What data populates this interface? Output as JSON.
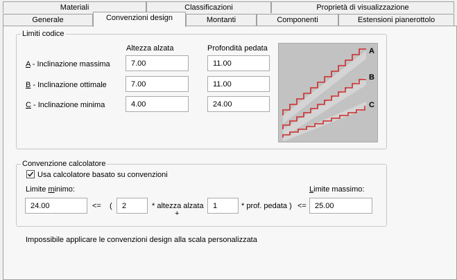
{
  "tabs_row1": [
    {
      "label": "Materiali"
    },
    {
      "label": "Classificazioni"
    },
    {
      "label": "Proprietà di visualizzazione"
    }
  ],
  "tabs_row2": [
    {
      "label": "Generale"
    },
    {
      "label": "Convenzioni design",
      "active": true
    },
    {
      "label": "Montanti"
    },
    {
      "label": "Componenti"
    },
    {
      "label": "Estensioni pianerottolo"
    }
  ],
  "limits": {
    "title": "Limiti codice",
    "col_riser": "Altezza alzata",
    "col_tread": "Profondità pedata",
    "rows": [
      {
        "key": "A",
        "rest": " - Inclinazione massima",
        "riser": "7.00",
        "tread": "11.00"
      },
      {
        "key": "B",
        "rest": " - Inclinazione ottimale",
        "riser": "7.00",
        "tread": "11.00"
      },
      {
        "key": "C",
        "rest": " - Inclinazione minima",
        "riser": "4.00",
        "tread": "24.00"
      }
    ],
    "diagram_labels": [
      "A",
      "B",
      "C"
    ]
  },
  "calculator": {
    "title": "Convenzione calcolatore",
    "use_label": "Usa calcolatore basato su convenzioni",
    "use_checked": true,
    "min_label_pre": "Limite ",
    "min_label_key": "m",
    "min_label_post": "inimo:",
    "max_label_key": "L",
    "max_label_post": "imite massimo:",
    "min_value": "24.00",
    "le1": "<=",
    "paren_open": "(",
    "riser_factor": "2",
    "riser_text": "* altezza alzata",
    "plus": "+",
    "tread_factor": "1",
    "tread_text": "* prof. pedata )",
    "le2": "<=",
    "max_value": "25.00"
  },
  "message": "Impossibile applicare le convenzioni design alla scala personalizzata",
  "colors": {
    "stair_red": "#cc2a2a",
    "stair_gray": "#d8d8d8"
  }
}
